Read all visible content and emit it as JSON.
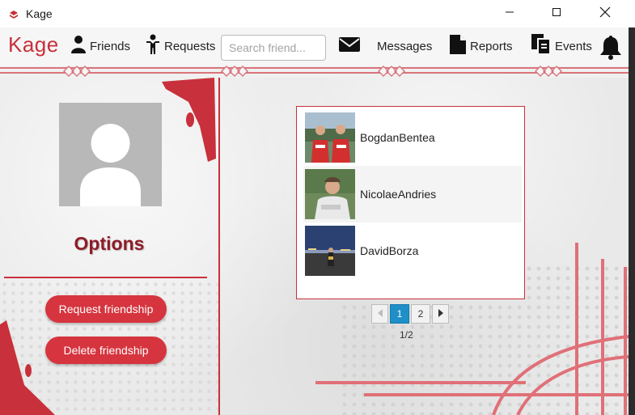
{
  "window": {
    "title": "Kage",
    "controls": [
      "minimize-icon",
      "maximize-icon",
      "close-icon"
    ]
  },
  "navbar": {
    "brand": "Kage",
    "items": [
      {
        "label": "Friends",
        "icon": "user-icon"
      },
      {
        "label": "Requests",
        "icon": "person-request-icon"
      },
      {
        "label": "Messages",
        "icon": "envelope-icon"
      },
      {
        "label": "Reports",
        "icon": "document-icon"
      },
      {
        "label": "Events",
        "icon": "copy-documents-icon"
      }
    ],
    "search_placeholder": "Search friend...",
    "notifications_icon": "bell-icon"
  },
  "sidebar": {
    "avatar_icon": "default-avatar-icon",
    "title": "Options",
    "buttons": [
      "Request friendship",
      "Delete friendship"
    ]
  },
  "friends": {
    "list": [
      {
        "name": "BogdanBentea"
      },
      {
        "name": "NicolaeAndries"
      },
      {
        "name": "DavidBorza"
      }
    ],
    "pagination": {
      "pages": [
        "1",
        "2"
      ],
      "current": "1",
      "info": "1/2"
    }
  },
  "colors": {
    "accent": "#c8303b",
    "title": "#8e1b26",
    "pager_active": "#1e8fc8"
  }
}
